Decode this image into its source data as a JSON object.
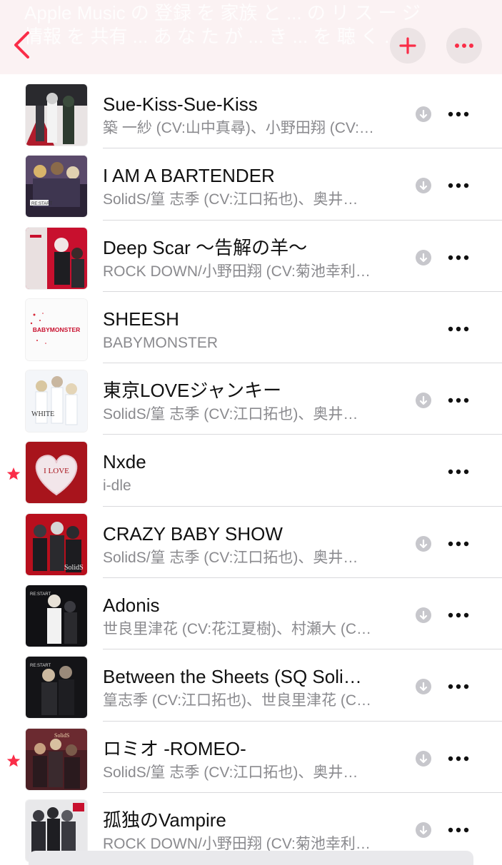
{
  "header": {
    "faded_text_line1": "Apple Music の 登録 を 家族 と ... の リ ス ー ジ",
    "faded_text_line2": "情報 を 共有 ... あ な た が ... き ... を 聴 く ...",
    "back_icon": "chevron-left-icon",
    "add_icon": "plus-icon",
    "more_icon": "ellipsis-icon",
    "accent_color": "#fa2d48"
  },
  "songs": [
    {
      "title": "Sue-Kiss-Sue-Kiss",
      "artist": "築 一紗 (CV:山中真尋)、小野田翔 (CV:…",
      "favorite": false,
      "downloadable": true
    },
    {
      "title": "I AM A BARTENDER",
      "artist": "SolidS/篁 志季 (CV:江口拓也)、奥井…",
      "favorite": false,
      "downloadable": true
    },
    {
      "title": "Deep Scar 〜告解の羊〜",
      "artist": "ROCK DOWN/小野田翔 (CV:菊池幸利…",
      "favorite": false,
      "downloadable": true
    },
    {
      "title": "SHEESH",
      "artist": "BABYMONSTER",
      "favorite": false,
      "downloadable": false
    },
    {
      "title": "東京LOVEジャンキー",
      "artist": "SolidS/篁 志季 (CV:江口拓也)、奥井…",
      "favorite": false,
      "downloadable": true
    },
    {
      "title": "Nxde",
      "artist": "i-dle",
      "favorite": true,
      "downloadable": false
    },
    {
      "title": "CRAZY BABY SHOW",
      "artist": "SolidS/篁 志季 (CV:江口拓也)、奥井…",
      "favorite": false,
      "downloadable": true
    },
    {
      "title": "Adonis",
      "artist": "世良里津花 (CV:花江夏樹)、村瀬大 (CV…",
      "favorite": false,
      "downloadable": true
    },
    {
      "title": "Between the Sheets (SQ Soli…",
      "artist": "篁志季 (CV:江口拓也)、世良里津花 (CV…",
      "favorite": false,
      "downloadable": true
    },
    {
      "title": "ロミオ -ROMEO-",
      "artist": "SolidS/篁 志季 (CV:江口拓也)、奥井…",
      "favorite": true,
      "downloadable": true
    },
    {
      "title": "孤独のVampire",
      "artist": "ROCK DOWN/小野田翔 (CV:菊池幸利…",
      "favorite": false,
      "downloadable": true
    }
  ],
  "artwork_text": {
    "babymonster": "BABYMONSTER",
    "white": "WHITE",
    "i_love": "I LOVE",
    "solids": "SolidS",
    "restart": "RE:START"
  }
}
